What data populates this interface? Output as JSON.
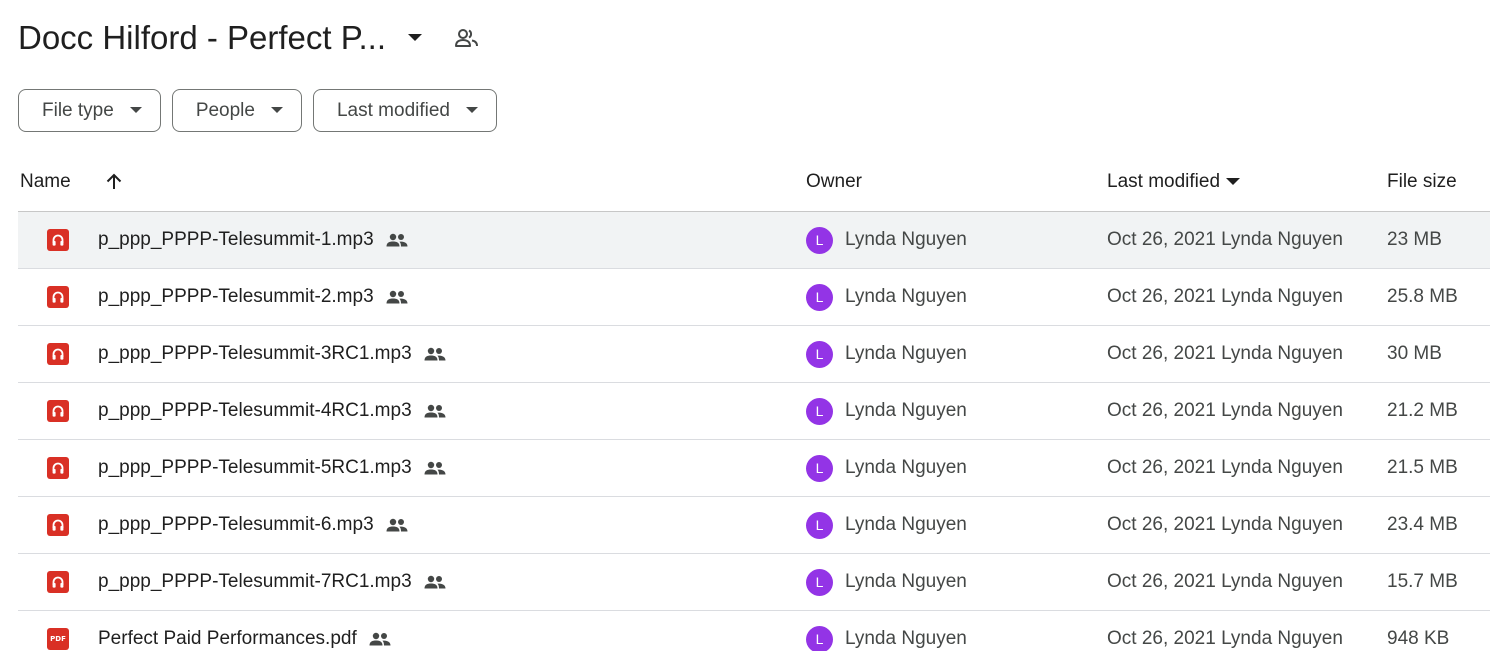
{
  "header": {
    "folder_title": "Docc Hilford - Perfect P...",
    "title_caret_icon": "arrow-drop-down-icon",
    "shared_icon": "people-outline-icon"
  },
  "filters": [
    {
      "label": "File type",
      "icon": "arrow-drop-down-icon"
    },
    {
      "label": "People",
      "icon": "arrow-drop-down-icon"
    },
    {
      "label": "Last modified",
      "icon": "arrow-drop-down-icon"
    }
  ],
  "table": {
    "columns": {
      "name": "Name",
      "owner": "Owner",
      "last_modified": "Last modified",
      "file_size": "File size"
    },
    "sort_icon": "arrow-upward-icon",
    "sort_caret_icon": "arrow-drop-down-icon",
    "rows": [
      {
        "type": "audio",
        "name": "p_ppp_PPPP-Telesummit-1.mp3",
        "owner_initial": "L",
        "owner": "Lynda Nguyen",
        "modified": "Oct 26, 2021 Lynda Nguyen",
        "size": "23 MB",
        "selected": true
      },
      {
        "type": "audio",
        "name": "p_ppp_PPPP-Telesummit-2.mp3",
        "owner_initial": "L",
        "owner": "Lynda Nguyen",
        "modified": "Oct 26, 2021 Lynda Nguyen",
        "size": "25.8 MB",
        "selected": false
      },
      {
        "type": "audio",
        "name": "p_ppp_PPPP-Telesummit-3RC1.mp3",
        "owner_initial": "L",
        "owner": "Lynda Nguyen",
        "modified": "Oct 26, 2021 Lynda Nguyen",
        "size": "30 MB",
        "selected": false
      },
      {
        "type": "audio",
        "name": "p_ppp_PPPP-Telesummit-4RC1.mp3",
        "owner_initial": "L",
        "owner": "Lynda Nguyen",
        "modified": "Oct 26, 2021 Lynda Nguyen",
        "size": "21.2 MB",
        "selected": false
      },
      {
        "type": "audio",
        "name": "p_ppp_PPPP-Telesummit-5RC1.mp3",
        "owner_initial": "L",
        "owner": "Lynda Nguyen",
        "modified": "Oct 26, 2021 Lynda Nguyen",
        "size": "21.5 MB",
        "selected": false
      },
      {
        "type": "audio",
        "name": "p_ppp_PPPP-Telesummit-6.mp3",
        "owner_initial": "L",
        "owner": "Lynda Nguyen",
        "modified": "Oct 26, 2021 Lynda Nguyen",
        "size": "23.4 MB",
        "selected": false
      },
      {
        "type": "audio",
        "name": "p_ppp_PPPP-Telesummit-7RC1.mp3",
        "owner_initial": "L",
        "owner": "Lynda Nguyen",
        "modified": "Oct 26, 2021 Lynda Nguyen",
        "size": "15.7 MB",
        "selected": false
      },
      {
        "type": "pdf",
        "name": "Perfect Paid Performances.pdf",
        "owner_initial": "L",
        "owner": "Lynda Nguyen",
        "modified": "Oct 26, 2021 Lynda Nguyen",
        "size": "948 KB",
        "selected": false
      }
    ]
  },
  "colors": {
    "audio_icon": "#d93025",
    "pdf_icon": "#d93025",
    "avatar": "#9334e6",
    "selected_row": "#f1f3f4"
  },
  "icons": {
    "audio": "headphones-icon",
    "pdf": "pdf-icon",
    "shared": "shared-people-icon",
    "pdf_label": "PDF"
  }
}
